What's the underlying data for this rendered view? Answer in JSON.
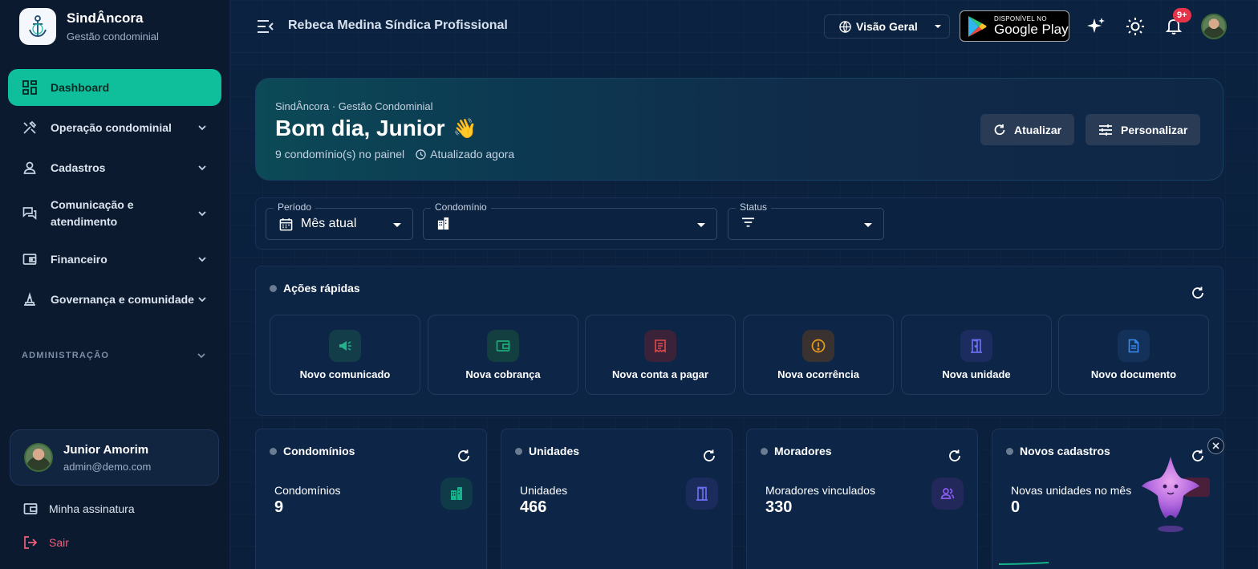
{
  "brand": {
    "name": "SindÂncora",
    "subtitle": "Gestão condominial"
  },
  "sidebar": {
    "items": [
      {
        "label": "Dashboard",
        "icon": "dashboard-icon",
        "active": true
      },
      {
        "label": "Operação condominial",
        "icon": "tools-icon"
      },
      {
        "label": "Cadastros",
        "icon": "person-icon"
      },
      {
        "label": "Comunicação e atendimento",
        "icon": "chat-icon"
      },
      {
        "label": "Financeiro",
        "icon": "wallet-icon"
      },
      {
        "label": "Governança e comunidade",
        "icon": "governance-icon"
      }
    ],
    "section_label": "ADMINISTRAÇÃO",
    "user": {
      "name": "Junior Amorim",
      "email": "admin@demo.com"
    },
    "links": {
      "subscription": "Minha assinatura",
      "logout": "Sair"
    }
  },
  "topbar": {
    "title": "Rebeca Medina Síndica Profissional",
    "scope": "Visão Geral",
    "gplay_small": "DISPONÍVEL NO",
    "gplay_big": "Google Play",
    "notifications_badge": "9+"
  },
  "hero": {
    "eyebrow": "SindÂncora · Gestão Condominial",
    "greeting": "Bom dia, Junior",
    "emoji": "👋",
    "count_text": "9 condomínio(s) no painel",
    "updated_text": "Atualizado agora",
    "refresh_label": "Atualizar",
    "customize_label": "Personalizar"
  },
  "filters": {
    "period_label": "Período",
    "period_value": "Mês atual",
    "condo_label": "Condomínio",
    "status_label": "Status"
  },
  "quick_actions": {
    "title": "Ações rápidas",
    "items": [
      {
        "label": "Novo comunicado",
        "icon": "megaphone-icon",
        "color": "#22b38a"
      },
      {
        "label": "Nova cobrança",
        "icon": "wallet-icon",
        "color": "#1faa78"
      },
      {
        "label": "Nova conta a pagar",
        "icon": "receipt-icon",
        "color": "#e04a4a"
      },
      {
        "label": "Nova ocorrência",
        "icon": "alert-icon",
        "color": "#e89a1b"
      },
      {
        "label": "Nova unidade",
        "icon": "door-icon",
        "color": "#6b6ef0"
      },
      {
        "label": "Novo documento",
        "icon": "document-icon",
        "color": "#3a8bef"
      }
    ]
  },
  "stats": [
    {
      "title": "Condomínios",
      "name": "Condomínios",
      "value": "9",
      "icon": "buildings-icon",
      "color": "#16b38c"
    },
    {
      "title": "Unidades",
      "name": "Unidades",
      "value": "466",
      "icon": "door-icon",
      "color": "#6b6ef0"
    },
    {
      "title": "Moradores",
      "name": "Moradores vinculados",
      "value": "330",
      "icon": "people-icon",
      "color": "#8a5cf0"
    },
    {
      "title": "Novos cadastros",
      "name": "Novas unidades no mês",
      "value": "0",
      "icon": "new-icon",
      "color": "#e04a6a"
    }
  ]
}
